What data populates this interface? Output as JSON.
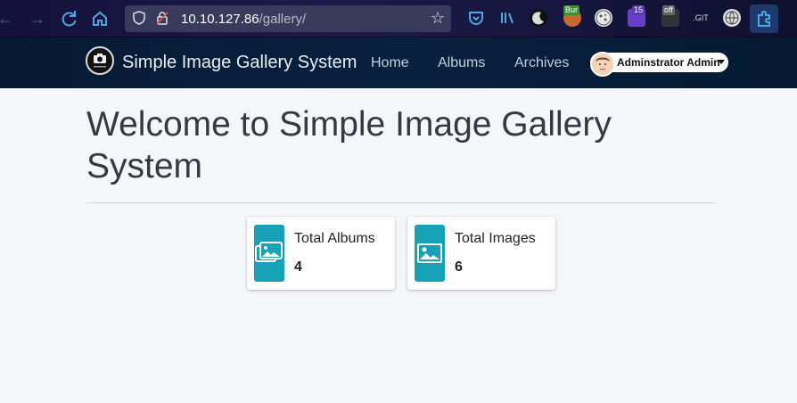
{
  "browser": {
    "url_host": "10.10.127.86",
    "url_path": "/gallery/",
    "extensions": {
      "burp_badge": "Bur",
      "badge_count": "15",
      "off_badge": "off",
      "git_label": ".GIT"
    }
  },
  "app": {
    "brand": "Simple Image Gallery System",
    "nav": {
      "home": "Home",
      "albums": "Albums",
      "archives": "Archives"
    },
    "user": "Adminstrator Admin"
  },
  "main": {
    "title": "Welcome to Simple Image Gallery System",
    "stats": [
      {
        "label": "Total Albums",
        "value": "4",
        "icon": "images-icon"
      },
      {
        "label": "Total Images",
        "value": "6",
        "icon": "image-icon"
      }
    ]
  },
  "colors": {
    "navbar": "#08213f",
    "accent": "#17a2b8",
    "background": "#f4f6f9"
  }
}
